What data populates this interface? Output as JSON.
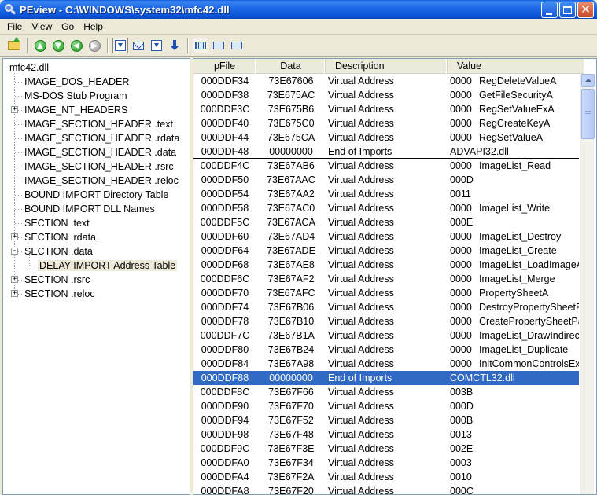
{
  "window": {
    "title": "PEview - C:\\WINDOWS\\system32\\mfc42.dll"
  },
  "menu": [
    {
      "key": "F",
      "rest": "ile"
    },
    {
      "key": "V",
      "rest": "iew"
    },
    {
      "key": "G",
      "rest": "o"
    },
    {
      "key": "H",
      "rest": "elp"
    }
  ],
  "tree": {
    "root": "mfc42.dll",
    "items": [
      {
        "label": "IMAGE_DOS_HEADER",
        "level": 1,
        "expander": ""
      },
      {
        "label": "MS-DOS Stub Program",
        "level": 1,
        "expander": ""
      },
      {
        "label": "IMAGE_NT_HEADERS",
        "level": 1,
        "expander": "+"
      },
      {
        "label": "IMAGE_SECTION_HEADER .text",
        "level": 1,
        "expander": ""
      },
      {
        "label": "IMAGE_SECTION_HEADER .rdata",
        "level": 1,
        "expander": ""
      },
      {
        "label": "IMAGE_SECTION_HEADER .data",
        "level": 1,
        "expander": ""
      },
      {
        "label": "IMAGE_SECTION_HEADER .rsrc",
        "level": 1,
        "expander": ""
      },
      {
        "label": "IMAGE_SECTION_HEADER .reloc",
        "level": 1,
        "expander": ""
      },
      {
        "label": "BOUND IMPORT Directory Table",
        "level": 1,
        "expander": ""
      },
      {
        "label": "BOUND IMPORT DLL Names",
        "level": 1,
        "expander": ""
      },
      {
        "label": "SECTION .text",
        "level": 1,
        "expander": ""
      },
      {
        "label": "SECTION .rdata",
        "level": 1,
        "expander": "+"
      },
      {
        "label": "SECTION .data",
        "level": 1,
        "expander": "-"
      },
      {
        "label": "DELAY IMPORT Address Table",
        "level": 2,
        "expander": "",
        "selected": true
      },
      {
        "label": "SECTION .rsrc",
        "level": 1,
        "expander": "+"
      },
      {
        "label": "SECTION .reloc",
        "level": 1,
        "expander": "+"
      }
    ]
  },
  "list": {
    "columns": [
      "pFile",
      "Data",
      "Description",
      "Value"
    ],
    "rows": [
      {
        "pfile": "000DDF34",
        "data": "73E67606",
        "desc": "Virtual Address",
        "hint": "0000",
        "name": "RegDeleteValueA"
      },
      {
        "pfile": "000DDF38",
        "data": "73E675AC",
        "desc": "Virtual Address",
        "hint": "0000",
        "name": "GetFileSecurityA"
      },
      {
        "pfile": "000DDF3C",
        "data": "73E675B6",
        "desc": "Virtual Address",
        "hint": "0000",
        "name": "RegSetValueExA"
      },
      {
        "pfile": "000DDF40",
        "data": "73E675C0",
        "desc": "Virtual Address",
        "hint": "0000",
        "name": "RegCreateKeyA"
      },
      {
        "pfile": "000DDF44",
        "data": "73E675CA",
        "desc": "Virtual Address",
        "hint": "0000",
        "name": "RegSetValueA"
      },
      {
        "pfile": "000DDF48",
        "data": "00000000",
        "desc": "End of Imports",
        "hint": "ADVAPI32.dll",
        "name": "",
        "divider": true
      },
      {
        "pfile": "000DDF4C",
        "data": "73E67AB6",
        "desc": "Virtual Address",
        "hint": "0000",
        "name": "ImageList_Read"
      },
      {
        "pfile": "000DDF50",
        "data": "73E67AAC",
        "desc": "Virtual Address",
        "hint": "000D",
        "name": ""
      },
      {
        "pfile": "000DDF54",
        "data": "73E67AA2",
        "desc": "Virtual Address",
        "hint": "0011",
        "name": ""
      },
      {
        "pfile": "000DDF58",
        "data": "73E67AC0",
        "desc": "Virtual Address",
        "hint": "0000",
        "name": "ImageList_Write"
      },
      {
        "pfile": "000DDF5C",
        "data": "73E67ACA",
        "desc": "Virtual Address",
        "hint": "000E",
        "name": ""
      },
      {
        "pfile": "000DDF60",
        "data": "73E67AD4",
        "desc": "Virtual Address",
        "hint": "0000",
        "name": "ImageList_Destroy"
      },
      {
        "pfile": "000DDF64",
        "data": "73E67ADE",
        "desc": "Virtual Address",
        "hint": "0000",
        "name": "ImageList_Create"
      },
      {
        "pfile": "000DDF68",
        "data": "73E67AE8",
        "desc": "Virtual Address",
        "hint": "0000",
        "name": "ImageList_LoadImageA"
      },
      {
        "pfile": "000DDF6C",
        "data": "73E67AF2",
        "desc": "Virtual Address",
        "hint": "0000",
        "name": "ImageList_Merge"
      },
      {
        "pfile": "000DDF70",
        "data": "73E67AFC",
        "desc": "Virtual Address",
        "hint": "0000",
        "name": "PropertySheetA"
      },
      {
        "pfile": "000DDF74",
        "data": "73E67B06",
        "desc": "Virtual Address",
        "hint": "0000",
        "name": "DestroyPropertySheetPage"
      },
      {
        "pfile": "000DDF78",
        "data": "73E67B10",
        "desc": "Virtual Address",
        "hint": "0000",
        "name": "CreatePropertySheetPageA"
      },
      {
        "pfile": "000DDF7C",
        "data": "73E67B1A",
        "desc": "Virtual Address",
        "hint": "0000",
        "name": "ImageList_DrawIndirect"
      },
      {
        "pfile": "000DDF80",
        "data": "73E67B24",
        "desc": "Virtual Address",
        "hint": "0000",
        "name": "ImageList_Duplicate"
      },
      {
        "pfile": "000DDF84",
        "data": "73E67A98",
        "desc": "Virtual Address",
        "hint": "0000",
        "name": "InitCommonControlsEx"
      },
      {
        "pfile": "000DDF88",
        "data": "00000000",
        "desc": "End of Imports",
        "hint": "COMCTL32.dll",
        "name": "",
        "selected": true
      },
      {
        "pfile": "000DDF8C",
        "data": "73E67F66",
        "desc": "Virtual Address",
        "hint": "003B",
        "name": ""
      },
      {
        "pfile": "000DDF90",
        "data": "73E67F70",
        "desc": "Virtual Address",
        "hint": "000D",
        "name": ""
      },
      {
        "pfile": "000DDF94",
        "data": "73E67F52",
        "desc": "Virtual Address",
        "hint": "000B",
        "name": ""
      },
      {
        "pfile": "000DDF98",
        "data": "73E67F48",
        "desc": "Virtual Address",
        "hint": "0013",
        "name": ""
      },
      {
        "pfile": "000DDF9C",
        "data": "73E67F3E",
        "desc": "Virtual Address",
        "hint": "002E",
        "name": ""
      },
      {
        "pfile": "000DDFA0",
        "data": "73E67F34",
        "desc": "Virtual Address",
        "hint": "0003",
        "name": ""
      },
      {
        "pfile": "000DDFA4",
        "data": "73E67F2A",
        "desc": "Virtual Address",
        "hint": "0010",
        "name": ""
      },
      {
        "pfile": "000DDFA8",
        "data": "73E67F20",
        "desc": "Virtual Address",
        "hint": "000C",
        "name": ""
      }
    ]
  },
  "colors": {
    "title_bar": "#0b53d6",
    "selection": "#316ac5",
    "chrome": "#ece9d8"
  }
}
